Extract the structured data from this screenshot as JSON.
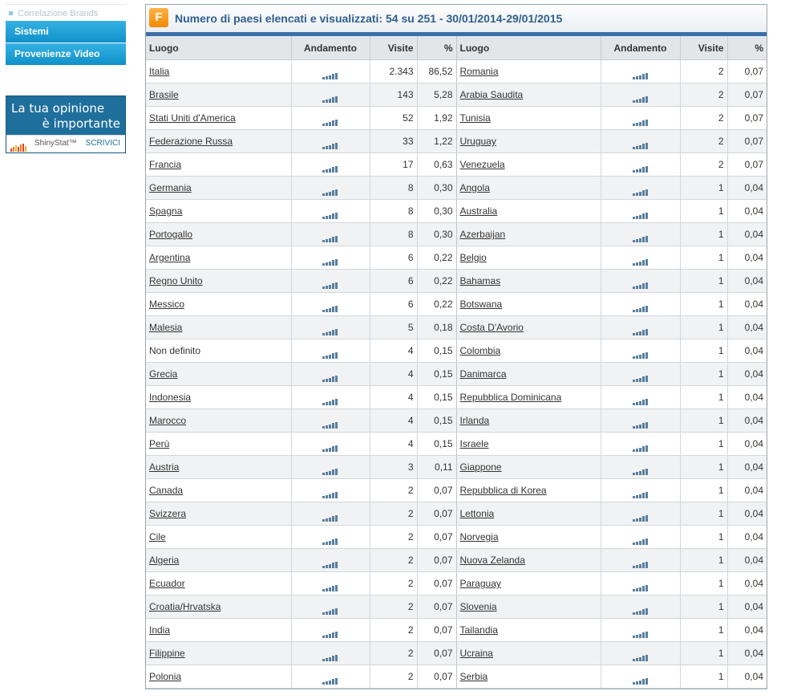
{
  "sidebar": {
    "faded_item": "Correlazione Brands",
    "buttons": [
      "Sistemi",
      "Provenienze Video"
    ]
  },
  "banner": {
    "line1": "La tua opinione",
    "line2": "è importante",
    "brand": "ShinyStat™",
    "cta": "SCRIVICI"
  },
  "panel": {
    "logo": "F",
    "title": "Numero di paesi elencati e visualizzati: 54 su 251 - 30/01/2014-29/01/2015",
    "headers": {
      "luogo": "Luogo",
      "andamento": "Andamento",
      "visite": "Visite",
      "pct": "%"
    },
    "trend_icon": "trend-bars-icon",
    "colors": {
      "header_bar": "#3a6fa8",
      "sidebar_button": "#1a9bd2",
      "logo": "#f39a1f"
    }
  },
  "rows": [
    {
      "left": {
        "luogo": "Italia",
        "visite": "2.343",
        "pct": "86,52",
        "link": true
      },
      "right": {
        "luogo": "Romania",
        "visite": "2",
        "pct": "0,07",
        "link": true
      }
    },
    {
      "left": {
        "luogo": "Brasile",
        "visite": "143",
        "pct": "5,28",
        "link": true
      },
      "right": {
        "luogo": "Arabia Saudita",
        "visite": "2",
        "pct": "0,07",
        "link": true
      }
    },
    {
      "left": {
        "luogo": "Stati Uniti d'America",
        "visite": "52",
        "pct": "1,92",
        "link": true
      },
      "right": {
        "luogo": "Tunisia",
        "visite": "2",
        "pct": "0,07",
        "link": true
      }
    },
    {
      "left": {
        "luogo": "Federazione Russa",
        "visite": "33",
        "pct": "1,22",
        "link": true
      },
      "right": {
        "luogo": "Uruguay",
        "visite": "2",
        "pct": "0,07",
        "link": true
      }
    },
    {
      "left": {
        "luogo": "Francia",
        "visite": "17",
        "pct": "0,63",
        "link": true
      },
      "right": {
        "luogo": "Venezuela",
        "visite": "2",
        "pct": "0,07",
        "link": true
      }
    },
    {
      "left": {
        "luogo": "Germania",
        "visite": "8",
        "pct": "0,30",
        "link": true
      },
      "right": {
        "luogo": "Angola",
        "visite": "1",
        "pct": "0,04",
        "link": true
      }
    },
    {
      "left": {
        "luogo": "Spagna",
        "visite": "8",
        "pct": "0,30",
        "link": true
      },
      "right": {
        "luogo": "Australia",
        "visite": "1",
        "pct": "0,04",
        "link": true
      }
    },
    {
      "left": {
        "luogo": "Portogallo",
        "visite": "8",
        "pct": "0,30",
        "link": true
      },
      "right": {
        "luogo": "Azerbaijan",
        "visite": "1",
        "pct": "0,04",
        "link": true
      }
    },
    {
      "left": {
        "luogo": "Argentina",
        "visite": "6",
        "pct": "0,22",
        "link": true
      },
      "right": {
        "luogo": "Belgio",
        "visite": "1",
        "pct": "0,04",
        "link": true
      }
    },
    {
      "left": {
        "luogo": "Regno Unito",
        "visite": "6",
        "pct": "0,22",
        "link": true
      },
      "right": {
        "luogo": "Bahamas",
        "visite": "1",
        "pct": "0,04",
        "link": true
      }
    },
    {
      "left": {
        "luogo": "Messico",
        "visite": "6",
        "pct": "0,22",
        "link": true
      },
      "right": {
        "luogo": "Botswana",
        "visite": "1",
        "pct": "0,04",
        "link": true
      }
    },
    {
      "left": {
        "luogo": "Malesia",
        "visite": "5",
        "pct": "0,18",
        "link": true
      },
      "right": {
        "luogo": "Costa D'Avorio",
        "visite": "1",
        "pct": "0,04",
        "link": true
      }
    },
    {
      "left": {
        "luogo": "Non definito",
        "visite": "4",
        "pct": "0,15",
        "link": false
      },
      "right": {
        "luogo": "Colombia",
        "visite": "1",
        "pct": "0,04",
        "link": true
      }
    },
    {
      "left": {
        "luogo": "Grecia",
        "visite": "4",
        "pct": "0,15",
        "link": true
      },
      "right": {
        "luogo": "Danimarca",
        "visite": "1",
        "pct": "0,04",
        "link": true
      }
    },
    {
      "left": {
        "luogo": "Indonesia",
        "visite": "4",
        "pct": "0,15",
        "link": true
      },
      "right": {
        "luogo": "Repubblica Dominicana",
        "visite": "1",
        "pct": "0,04",
        "link": true
      }
    },
    {
      "left": {
        "luogo": "Marocco",
        "visite": "4",
        "pct": "0,15",
        "link": true
      },
      "right": {
        "luogo": "Irlanda",
        "visite": "1",
        "pct": "0,04",
        "link": true
      }
    },
    {
      "left": {
        "luogo": "Perù",
        "visite": "4",
        "pct": "0,15",
        "link": true
      },
      "right": {
        "luogo": "Israele",
        "visite": "1",
        "pct": "0,04",
        "link": true
      }
    },
    {
      "left": {
        "luogo": "Austria",
        "visite": "3",
        "pct": "0,11",
        "link": true
      },
      "right": {
        "luogo": "Giappone",
        "visite": "1",
        "pct": "0,04",
        "link": true
      }
    },
    {
      "left": {
        "luogo": "Canada",
        "visite": "2",
        "pct": "0,07",
        "link": true
      },
      "right": {
        "luogo": "Repubblica di Korea",
        "visite": "1",
        "pct": "0,04",
        "link": true
      }
    },
    {
      "left": {
        "luogo": "Svizzera",
        "visite": "2",
        "pct": "0,07",
        "link": true
      },
      "right": {
        "luogo": "Lettonia",
        "visite": "1",
        "pct": "0,04",
        "link": true
      }
    },
    {
      "left": {
        "luogo": "Cile",
        "visite": "2",
        "pct": "0,07",
        "link": true
      },
      "right": {
        "luogo": "Norvegia",
        "visite": "1",
        "pct": "0,04",
        "link": true
      }
    },
    {
      "left": {
        "luogo": "Algeria",
        "visite": "2",
        "pct": "0,07",
        "link": true
      },
      "right": {
        "luogo": "Nuova Zelanda",
        "visite": "1",
        "pct": "0,04",
        "link": true
      }
    },
    {
      "left": {
        "luogo": "Ecuador",
        "visite": "2",
        "pct": "0,07",
        "link": true
      },
      "right": {
        "luogo": "Paraguay",
        "visite": "1",
        "pct": "0,04",
        "link": true
      }
    },
    {
      "left": {
        "luogo": "Croatia/Hrvatska",
        "visite": "2",
        "pct": "0,07",
        "link": true
      },
      "right": {
        "luogo": "Slovenia",
        "visite": "1",
        "pct": "0,04",
        "link": true
      }
    },
    {
      "left": {
        "luogo": "India",
        "visite": "2",
        "pct": "0,07",
        "link": true
      },
      "right": {
        "luogo": "Tailandia",
        "visite": "1",
        "pct": "0,04",
        "link": true
      }
    },
    {
      "left": {
        "luogo": "Filippine",
        "visite": "2",
        "pct": "0,07",
        "link": true
      },
      "right": {
        "luogo": "Ucraina",
        "visite": "1",
        "pct": "0,04",
        "link": true
      }
    },
    {
      "left": {
        "luogo": "Polonia",
        "visite": "2",
        "pct": "0,07",
        "link": true
      },
      "right": {
        "luogo": "Serbia",
        "visite": "1",
        "pct": "0,04",
        "link": true
      }
    }
  ]
}
